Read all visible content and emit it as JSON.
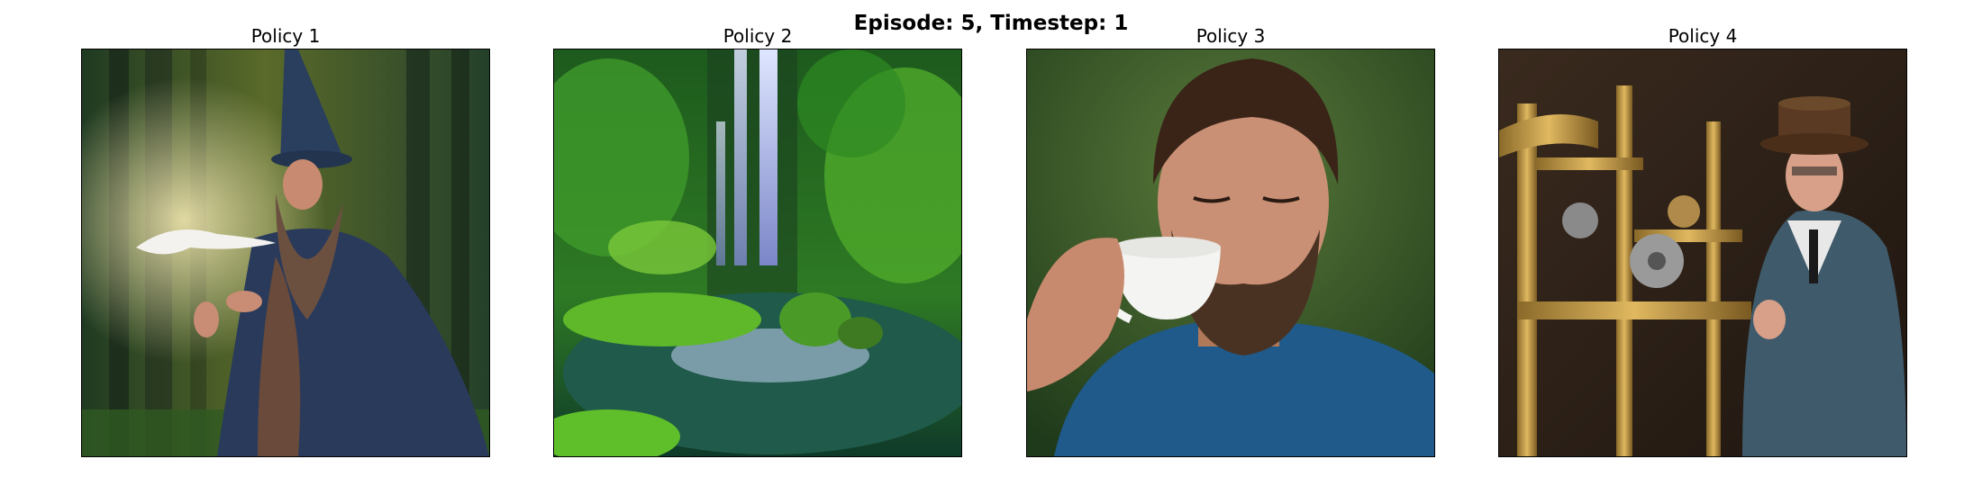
{
  "figure": {
    "suptitle": "Episode: 5, Timestep: 1"
  },
  "panels": [
    {
      "title": "Policy 1",
      "image": "wizard-in-forest-image"
    },
    {
      "title": "Policy 2",
      "image": "jungle-waterfall-image"
    },
    {
      "title": "Policy 3",
      "image": "bearded-man-drinking-coffee-image"
    },
    {
      "title": "Policy 4",
      "image": "steampunk-inventor-with-machine-image"
    }
  ]
}
